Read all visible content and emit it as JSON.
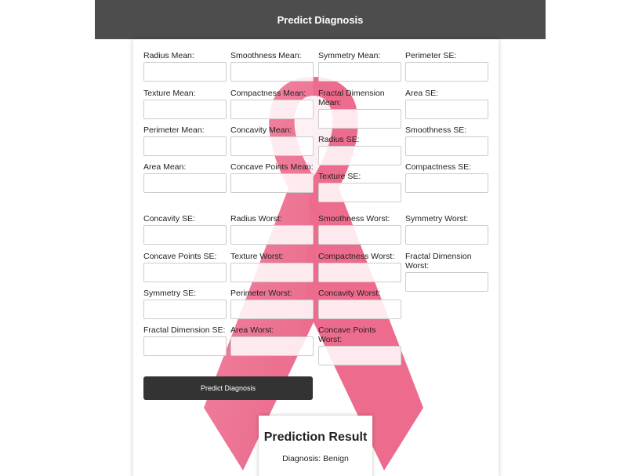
{
  "header": {
    "title": "Predict Diagnosis"
  },
  "form": {
    "fields": [
      {
        "label": "Radius Mean:",
        "value": ""
      },
      {
        "label": "Texture Mean:",
        "value": ""
      },
      {
        "label": "Perimeter Mean:",
        "value": ""
      },
      {
        "label": "Area Mean:",
        "value": ""
      },
      {
        "label": "Smoothness Mean:",
        "value": ""
      },
      {
        "label": "Compactness Mean:",
        "value": ""
      },
      {
        "label": "Concavity Mean:",
        "value": ""
      },
      {
        "label": "Concave Points Mean:",
        "value": ""
      },
      {
        "label": "Symmetry Mean:",
        "value": ""
      },
      {
        "label": "Fractal Dimension Mean:",
        "value": ""
      },
      {
        "label": "Radius SE:",
        "value": ""
      },
      {
        "label": "Texture SE:",
        "value": ""
      },
      {
        "label": "Perimeter SE:",
        "value": ""
      },
      {
        "label": "Area SE:",
        "value": ""
      },
      {
        "label": "Smoothness SE:",
        "value": ""
      },
      {
        "label": "Compactness SE:",
        "value": ""
      },
      {
        "label": "Concavity SE:",
        "value": ""
      },
      {
        "label": "Concave Points SE:",
        "value": ""
      },
      {
        "label": "Symmetry SE:",
        "value": ""
      },
      {
        "label": "Fractal Dimension SE:",
        "value": ""
      },
      {
        "label": "Radius Worst:",
        "value": ""
      },
      {
        "label": "Texture Worst:",
        "value": ""
      },
      {
        "label": "Perimeter Worst:",
        "value": ""
      },
      {
        "label": "Area Worst:",
        "value": ""
      },
      {
        "label": "Smoothness Worst:",
        "value": ""
      },
      {
        "label": "Compactness Worst:",
        "value": ""
      },
      {
        "label": "Concavity Worst:",
        "value": ""
      },
      {
        "label": "Concave Points Worst:",
        "value": ""
      },
      {
        "label": "Symmetry Worst:",
        "value": ""
      },
      {
        "label": "Fractal Dimension Worst:",
        "value": ""
      }
    ],
    "submit_label": "Predict Diagnosis"
  },
  "result": {
    "title": "Prediction Result",
    "diagnosis": "Diagnosis: Benign"
  },
  "colors": {
    "header_bg": "#4d4d4d",
    "button_bg": "#333333",
    "ribbon": "#e8436e"
  },
  "icons": {
    "background": "pink-ribbon-icon"
  }
}
